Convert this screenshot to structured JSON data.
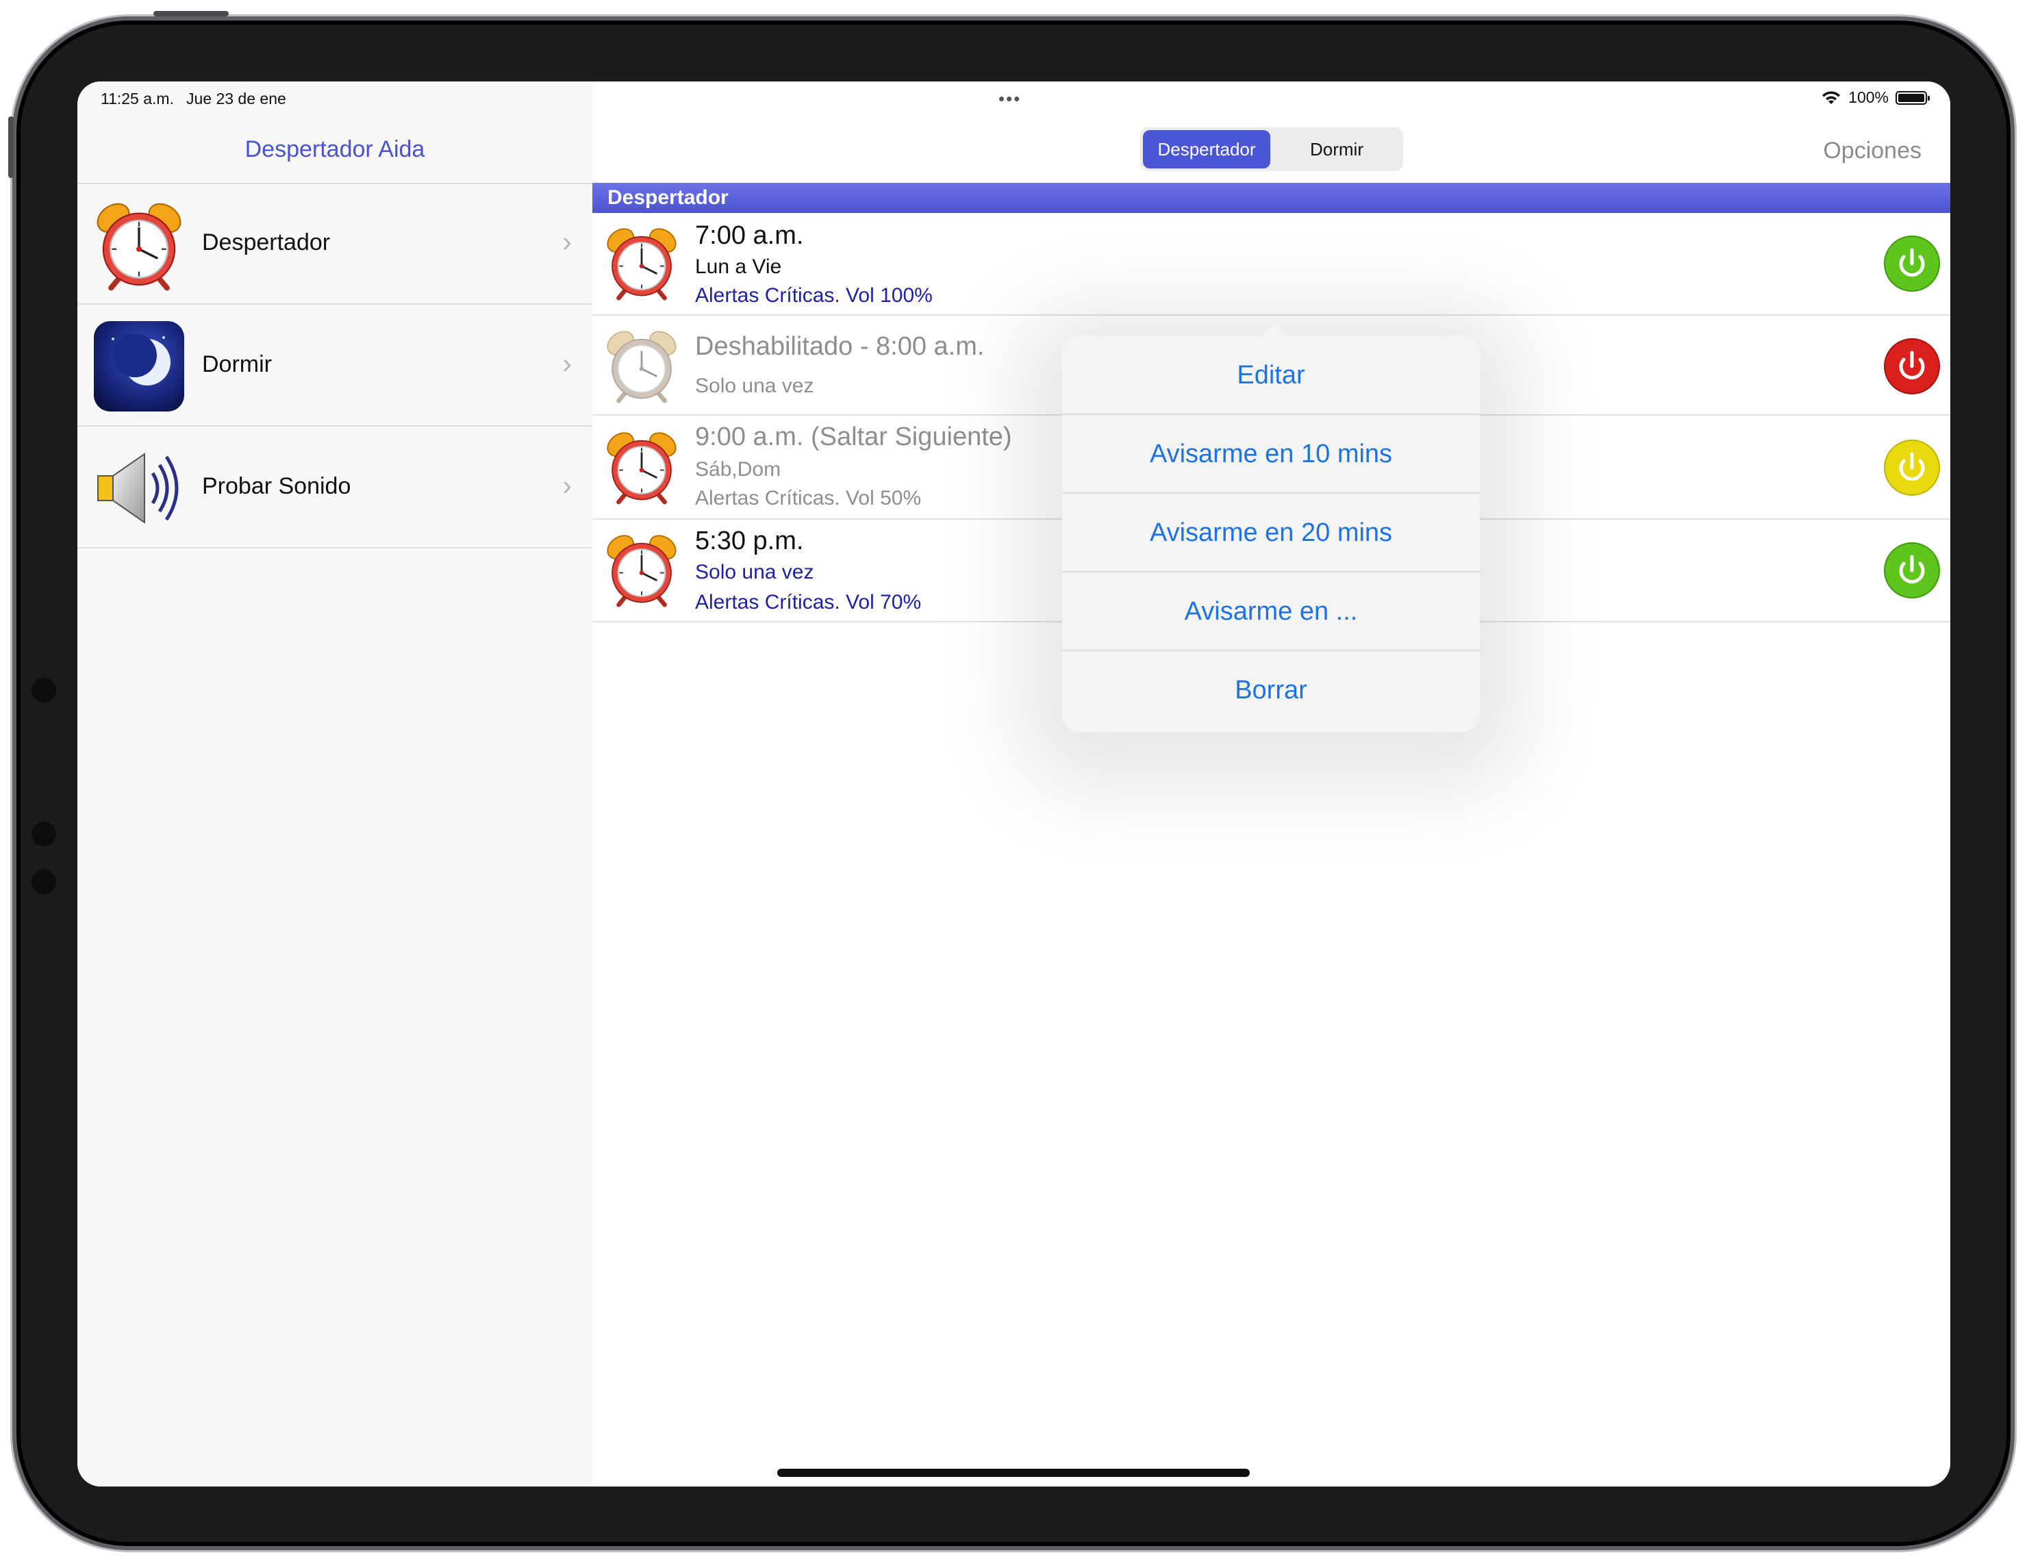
{
  "status": {
    "time": "11:25 a.m.",
    "date": "Jue 23 de ene",
    "battery": "100%"
  },
  "sidebar": {
    "title": "Despertador Aida",
    "items": [
      {
        "label": "Despertador",
        "icon": "alarm-clock-icon"
      },
      {
        "label": "Dormir",
        "icon": "moon-icon"
      },
      {
        "label": "Probar Sonido",
        "icon": "speaker-icon"
      }
    ]
  },
  "toolbar": {
    "segments": [
      "Despertador",
      "Dormir"
    ],
    "selected": "Despertador",
    "options": "Opciones"
  },
  "section": {
    "title": "Despertador"
  },
  "alarms": [
    {
      "time": "7:00 a.m.",
      "days": "Lun a Vie",
      "alerts": "Alertas Críticas. Vol 100%",
      "state": "on",
      "power_color": "#5fc41c"
    },
    {
      "time": "Deshabilitado - 8:00 a.m.",
      "days": "Solo una vez",
      "alerts": "",
      "state": "off",
      "power_color": "#d9201c"
    },
    {
      "time": "9:00 a.m. (Saltar Siguiente)",
      "days": "Sáb,Dom",
      "alerts": "Alertas Críticas. Vol 50%",
      "state": "skip",
      "power_color": "#e8da0c"
    },
    {
      "time": "5:30 p.m.",
      "days": "Solo una vez",
      "alerts": "Alertas Críticas. Vol 70%",
      "state": "on",
      "power_color": "#5fc41c"
    }
  ],
  "popover": {
    "items": [
      "Editar",
      "Avisarme en 10 mins",
      "Avisarme en 20 mins",
      "Avisarme en ...",
      "Borrar"
    ]
  },
  "colors": {
    "accent": "#4a52cf",
    "link": "#1e73e4",
    "header_blue": "#1f1fa8"
  }
}
